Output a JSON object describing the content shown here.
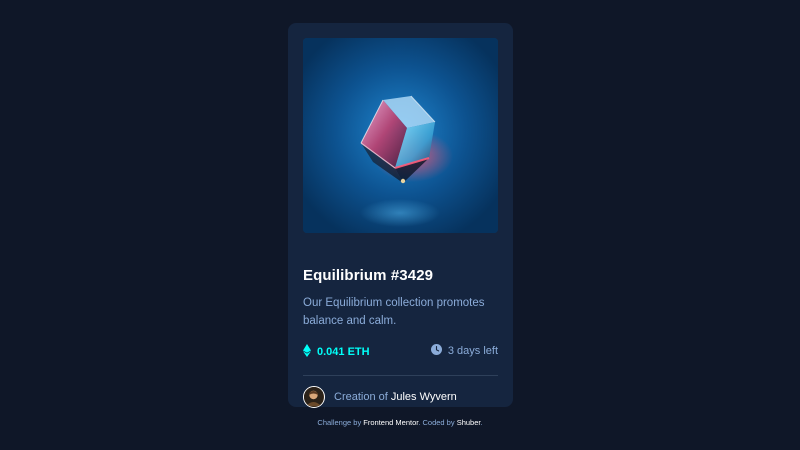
{
  "card": {
    "image_alt": "Equilibrium cube",
    "title": "Equilibrium #3429",
    "description": "Our Equilibrium collection promotes balance and calm.",
    "price": "0.041 ETH",
    "time_left": "3 days left",
    "creator_prefix": "Creation of",
    "creator_name": "Jules Wyvern"
  },
  "attribution": {
    "prefix": "Challenge by",
    "challenge_link": "Frontend Mentor",
    "middle": ". Coded by",
    "coder_link": "Shuber",
    "suffix": "."
  },
  "icons": {
    "price": "ethereum-icon",
    "time": "clock-icon"
  },
  "colors": {
    "background": "#0f1728",
    "card": "#15253f",
    "accent": "#00fff8",
    "muted": "#8bacd9",
    "divider": "#2e405a"
  }
}
